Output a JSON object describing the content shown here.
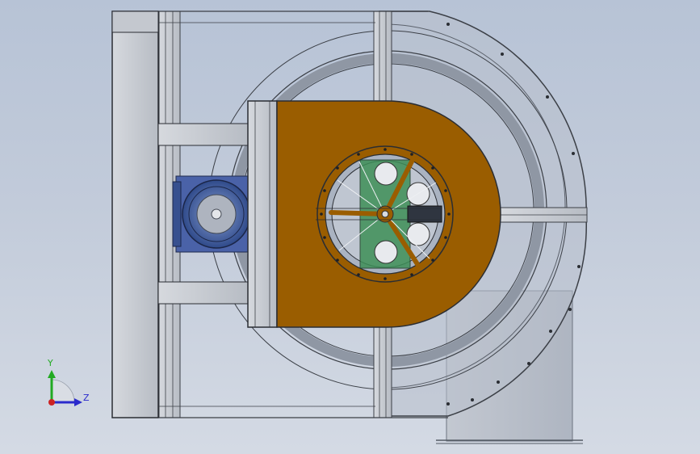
{
  "viewport": {
    "triad": {
      "y_label": "Y",
      "z_label": "Z"
    }
  },
  "colors": {
    "background_top": "#b7c3d6",
    "background_bottom": "#d4dae4",
    "frame_steel": "#c8ccd3",
    "scroll_housing": "#9aa3b1",
    "inlet_cone": "#9a5d00",
    "motor": "#3f5aa0",
    "outlet_duct": "#c9ced6",
    "axis_y": "#22aa22",
    "axis_z": "#2a2acc",
    "axis_origin": "#cc2222"
  }
}
